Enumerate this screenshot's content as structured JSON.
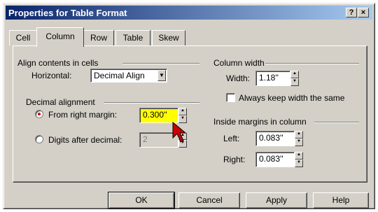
{
  "dialog": {
    "title": "Properties for Table Format",
    "help_glyph": "?",
    "close_glyph": "×"
  },
  "tabs": [
    {
      "label": "Cell"
    },
    {
      "label": "Column"
    },
    {
      "label": "Row"
    },
    {
      "label": "Table"
    },
    {
      "label": "Skew"
    }
  ],
  "align": {
    "group_label": "Align contents in cells",
    "horizontal_label": "Horizontal:",
    "horizontal_value": "Decimal Align"
  },
  "decimal": {
    "group_label": "Decimal alignment",
    "from_right_label": "From right margin:",
    "from_right_value": "0.300''",
    "from_right_selected": true,
    "digits_label": "Digits after decimal:",
    "digits_value": "2",
    "digits_selected": false
  },
  "column_width": {
    "group_label": "Column width",
    "width_label": "Width:",
    "width_value": "1.18''",
    "keep_label": "Always keep width the same",
    "keep_checked": false
  },
  "margins": {
    "group_label": "Inside margins in column",
    "left_label": "Left:",
    "left_value": "0.083''",
    "right_label": "Right:",
    "right_value": "0.083''"
  },
  "buttons": {
    "ok": "OK",
    "cancel": "Cancel",
    "apply": "Apply",
    "help": "Help"
  },
  "colors": {
    "highlight": "#ffff00",
    "radio_selected": "#d40000",
    "cursor": "#cc0000"
  }
}
